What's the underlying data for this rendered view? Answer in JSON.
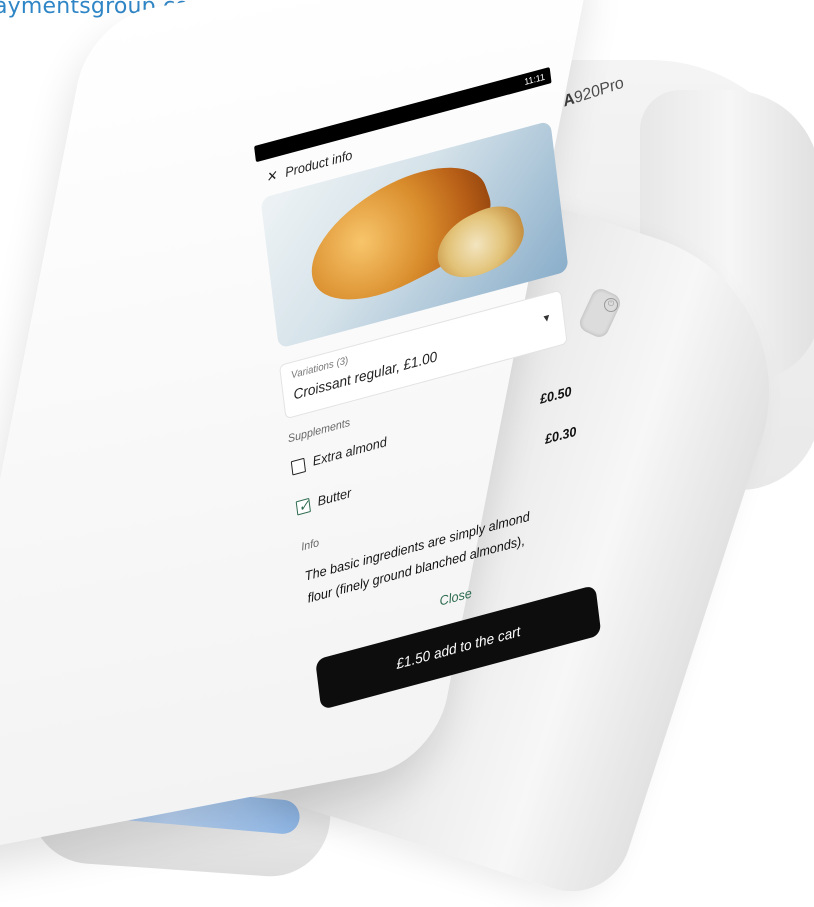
{
  "website": {
    "url_fragment": "aymentsgroup.com"
  },
  "device": {
    "model_label": "A920Pro",
    "model_prefix": "A",
    "model_suffix": "920Pro"
  },
  "status_bar": {
    "time": "11:11"
  },
  "product_info": {
    "title": "Product info",
    "variations": {
      "label": "Variations (3)",
      "selected": "Croissant regular, £1.00"
    },
    "supplements": {
      "label": "Supplements",
      "items": [
        {
          "name": "Extra almond",
          "price": "£0.50",
          "checked": false
        },
        {
          "name": "Butter",
          "price": "£0.30",
          "checked": true
        }
      ]
    },
    "info": {
      "label": "Info",
      "text_line1": "The basic ingredients are simply almond",
      "text_line2": "flour (finely ground blanched almonds),"
    },
    "close_label": "Close",
    "add_to_cart_label": "£1.50 add to the cart"
  },
  "colors": {
    "accent": "#2d6b4f",
    "url_blue": "#2f86c6",
    "button_black": "#0d0d0d"
  },
  "icons": {
    "close": "close-icon",
    "dropdown": "chevron-down-icon",
    "power": "power-icon",
    "check": "checkmark-icon"
  }
}
